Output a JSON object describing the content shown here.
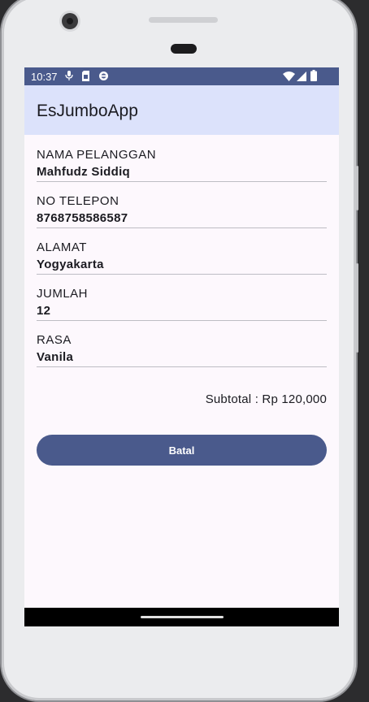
{
  "status_bar": {
    "time": "10:37",
    "left_icons": [
      "mic-icon",
      "sim-card-icon",
      "sync-icon"
    ],
    "right_icons": [
      "wifi-icon",
      "signal-icon",
      "battery-icon"
    ]
  },
  "app_bar": {
    "title": "EsJumboApp"
  },
  "fields": [
    {
      "label": "NAMA PELANGGAN",
      "value": "Mahfudz Siddiq"
    },
    {
      "label": "NO TELEPON",
      "value": "8768758586587"
    },
    {
      "label": "ALAMAT",
      "value": "Yogyakarta"
    },
    {
      "label": "JUMLAH",
      "value": "12"
    },
    {
      "label": "RASA",
      "value": "Vanila"
    }
  ],
  "summary": {
    "subtotal": "Subtotal : Rp 120,000"
  },
  "actions": {
    "cancel_label": "Batal"
  },
  "colors": {
    "primary": "#4a5a8c",
    "app_bar_bg": "#dce2fb",
    "screen_bg": "#fdf8fd",
    "divider": "#bdbdc4"
  }
}
